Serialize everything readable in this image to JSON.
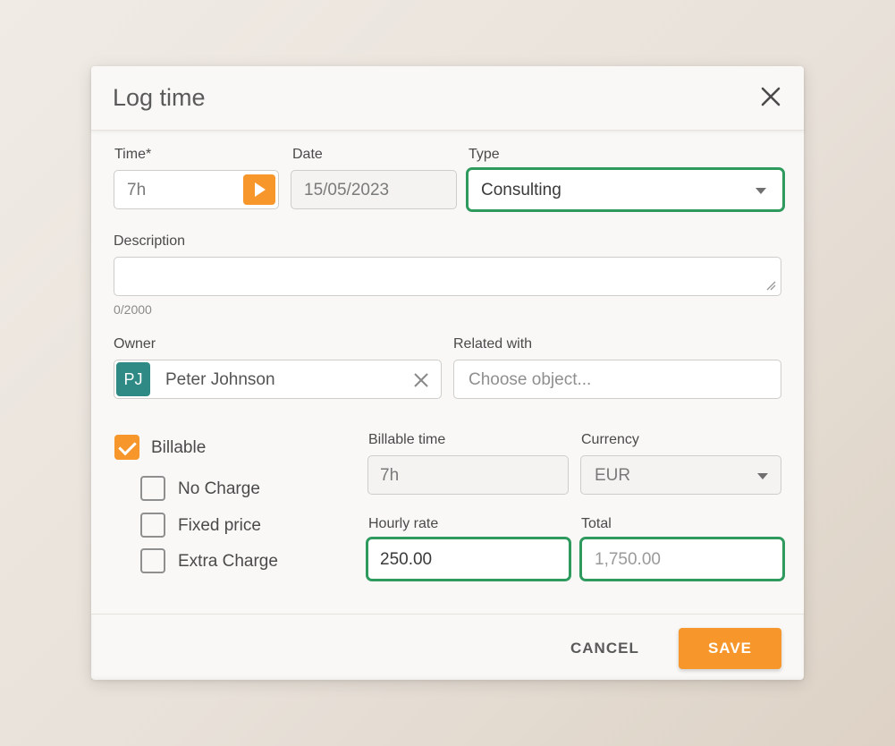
{
  "dialog": {
    "title": "Log time",
    "close_icon": "close-icon"
  },
  "time": {
    "label": "Time*",
    "value": "7h",
    "start_icon": "play-icon"
  },
  "date": {
    "label": "Date",
    "value": "15/05/2023"
  },
  "type": {
    "label": "Type",
    "value": "Consulting",
    "dropdown_icon": "caret-down-icon"
  },
  "description": {
    "label": "Description",
    "value": "",
    "counter": "0/2000",
    "resize_icon": "resize-handle-icon"
  },
  "owner": {
    "label": "Owner",
    "initials": "PJ",
    "name": "Peter Johnson",
    "clear_icon": "clear-icon"
  },
  "related": {
    "label": "Related with",
    "placeholder": "Choose object..."
  },
  "billing": {
    "billable_label": "Billable",
    "billable_checked": true,
    "options": [
      {
        "label": "No Charge",
        "checked": false
      },
      {
        "label": "Fixed price",
        "checked": false
      },
      {
        "label": "Extra Charge",
        "checked": false
      }
    ]
  },
  "billable_time": {
    "label": "Billable time",
    "value": "7h"
  },
  "currency": {
    "label": "Currency",
    "value": "EUR"
  },
  "hourly_rate": {
    "label": "Hourly rate",
    "value": "250.00"
  },
  "total": {
    "label": "Total",
    "value": "1,750.00"
  },
  "footer": {
    "cancel_label": "CANCEL",
    "save_label": "SAVE"
  },
  "colors": {
    "accent": "#f6962b",
    "focus": "#2e9a5e",
    "avatar": "#2f8a86"
  }
}
